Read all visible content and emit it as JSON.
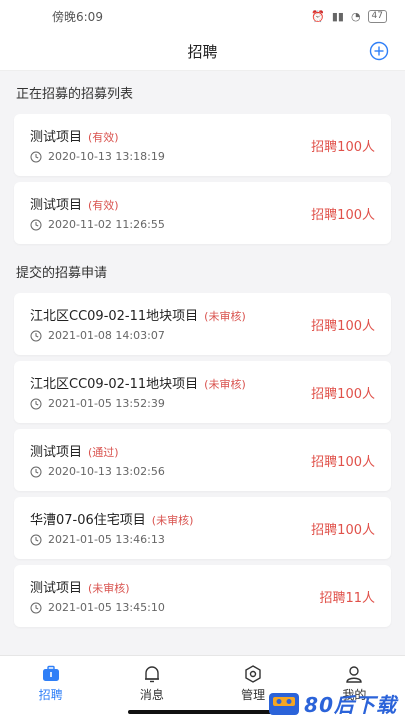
{
  "status_bar": {
    "time": "傍晚6:09",
    "battery": "47"
  },
  "header": {
    "title": "招聘"
  },
  "sections": [
    {
      "title": "正在招募的招募列表",
      "items": [
        {
          "name": "测试项目",
          "status": "(有效)",
          "time": "2020-10-13 13:18:19",
          "count": "招聘100人"
        },
        {
          "name": "测试项目",
          "status": "(有效)",
          "time": "2020-11-02 11:26:55",
          "count": "招聘100人"
        }
      ]
    },
    {
      "title": "提交的招募申请",
      "items": [
        {
          "name": "江北区CC09-02-11地块项目",
          "status": "(未审核)",
          "time": "2021-01-08 14:03:07",
          "count": "招聘100人"
        },
        {
          "name": "江北区CC09-02-11地块项目",
          "status": "(未审核)",
          "time": "2021-01-05 13:52:39",
          "count": "招聘100人"
        },
        {
          "name": "测试项目",
          "status": "(通过)",
          "time": "2020-10-13 13:02:56",
          "count": "招聘100人"
        },
        {
          "name": "华漕07-06住宅项目",
          "status": "(未审核)",
          "time": "2021-01-05 13:46:13",
          "count": "招聘100人"
        },
        {
          "name": "测试项目",
          "status": "(未审核)",
          "time": "2021-01-05 13:45:10",
          "count": "招聘11人"
        }
      ]
    }
  ],
  "tabs": [
    {
      "label": "招聘",
      "active": true
    },
    {
      "label": "消息"
    },
    {
      "label": "管理"
    },
    {
      "label": "我的"
    }
  ],
  "watermark": {
    "text": "80后下载"
  },
  "colors": {
    "accent": "#2f7ff7",
    "status_red": "#d9534f"
  }
}
